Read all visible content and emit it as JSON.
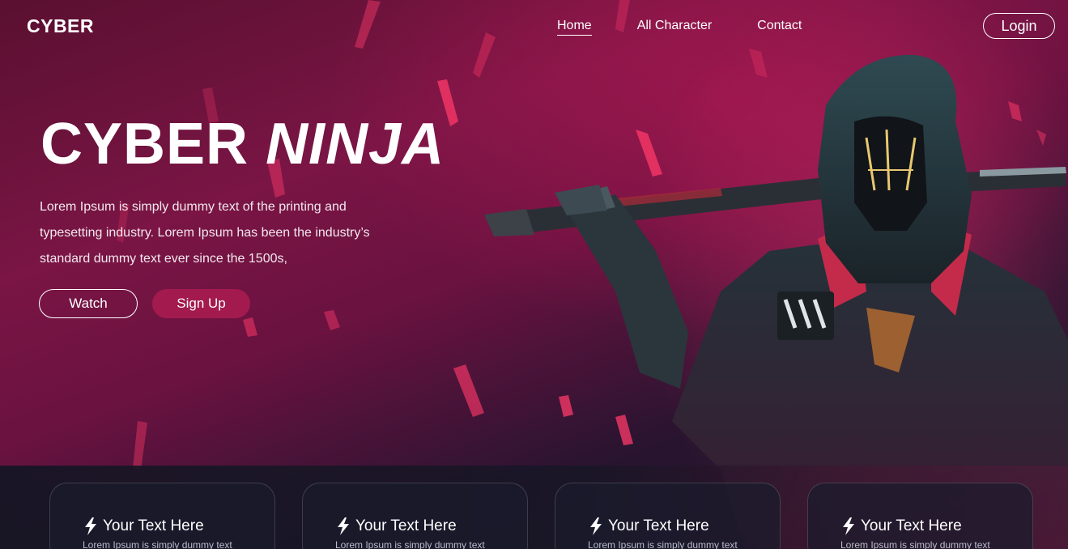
{
  "navbar": {
    "logo": "CYBER",
    "links": [
      "Home",
      "All Character",
      "Contact"
    ],
    "login_label": "Login"
  },
  "hero": {
    "title_part1": "CYBER",
    "title_part2": "NINJA",
    "description": "Lorem Ipsum is simply dummy text of the printing and typesetting industry. Lorem Ipsum has been the industry’s standard dummy text ever since the 1500s,",
    "watch_label": "Watch",
    "signup_label": "Sign Up"
  },
  "cards": [
    {
      "title": "Your Text Here",
      "text": "Lorem Ipsum is simply dummy text",
      "icon": "lightning-icon"
    },
    {
      "title": "Your Text Here",
      "text": "Lorem Ipsum is simply dummy text",
      "icon": "lightning-icon"
    },
    {
      "title": "Your Text Here",
      "text": "Lorem Ipsum is simply dummy text",
      "icon": "lightning-icon"
    },
    {
      "title": "Your Text Here",
      "text": "Lorem Ipsum is simply dummy text",
      "icon": "lightning-icon"
    }
  ],
  "colors": {
    "accent": "#a31a4e",
    "background_dark": "#161826",
    "background_magenta": "#7a1545",
    "spark": "#ff3a6a"
  }
}
